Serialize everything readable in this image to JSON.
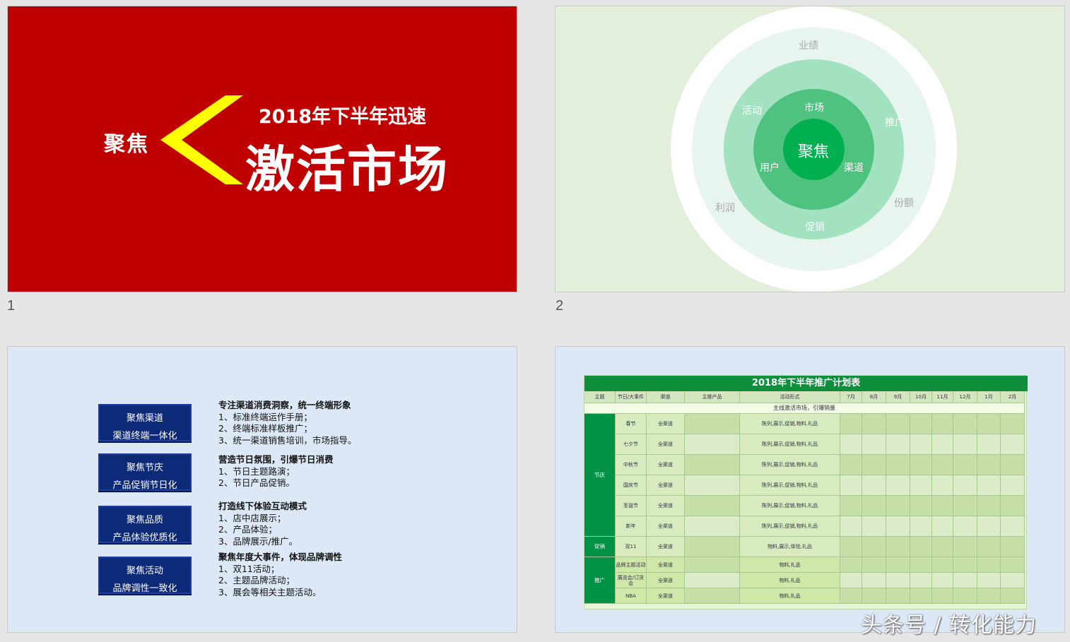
{
  "slides": [
    {
      "number": "1"
    },
    {
      "number": "2"
    },
    {
      "number": "3"
    },
    {
      "number": "4"
    }
  ],
  "slide1": {
    "focus": "聚焦",
    "subtitle": "2018年下半年迅速",
    "title": "激活市场",
    "bg_color": "#c00000",
    "chevron_color": "#ffff00"
  },
  "slide2": {
    "center": "聚焦",
    "inner_labels": {
      "top": "市场",
      "left": "用户",
      "right": "渠道"
    },
    "middle_labels": {
      "top_left": "活动",
      "right": "推广",
      "bottom": "促销"
    },
    "outer_labels": {
      "top": "业绩",
      "left": "利润",
      "right": "份额"
    },
    "colors": [
      "#00b050",
      "#4ec27e",
      "#a2e2c0",
      "#e7f5ee",
      "#ffffff"
    ]
  },
  "slide3": {
    "items": [
      {
        "box_line1": "聚焦渠道",
        "box_line2": "渠道终端一体化",
        "head": "专注渠道消费洞察，统一终端形象",
        "points": [
          "1、标准终端运作手册；",
          "2、终端标准样板推广；",
          "3、统一渠道销售培训，市场指导。"
        ]
      },
      {
        "box_line1": "聚焦节庆",
        "box_line2": "产品促销节日化",
        "head": "营造节日氛围，引爆节日消费",
        "points": [
          "1、节日主题路演；",
          "2、节日产品促销。"
        ]
      },
      {
        "box_line1": "聚焦品质",
        "box_line2": "产品体验优质化",
        "head": "打造线下体验互动模式",
        "points": [
          "1、店中店展示；",
          "2、产品体验；",
          "3、品牌展示/推广。"
        ]
      },
      {
        "box_line1": "聚焦活动",
        "box_line2": "品牌调性一致化",
        "head": "聚焦年度大事件，体现品牌调性",
        "points": [
          "1、双11活动；",
          "2、主题品牌活动；",
          "3、展会等相关主题活动。"
        ]
      }
    ]
  },
  "slide4": {
    "table_title": "2018年下半年推广计划表",
    "headers": [
      "主题",
      "节日/大事件",
      "渠道",
      "主推产品",
      "活动形式",
      "7月",
      "8月",
      "9月",
      "10月",
      "11月",
      "12月",
      "1月",
      "2月"
    ],
    "banner": "主线激活市场，引爆销量",
    "groups": [
      {
        "name": "节庆",
        "rows": [
          {
            "event": "春节",
            "channel": "全渠道",
            "form": "陈列,展示,促销,物料,礼品"
          },
          {
            "event": "七夕节",
            "channel": "全渠道",
            "form": "陈列,展示,促销,物料,礼品"
          },
          {
            "event": "中秋节",
            "channel": "全渠道",
            "form": "陈列,展示,促销,物料,礼品"
          },
          {
            "event": "国庆节",
            "channel": "全渠道",
            "form": "陈列,展示,促销,物料,礼品"
          },
          {
            "event": "圣诞节",
            "channel": "全渠道",
            "form": "陈列,展示,促销,物料,礼品"
          },
          {
            "event": "新年",
            "channel": "全渠道",
            "form": "陈列,展示,促销,物料,礼品"
          }
        ]
      },
      {
        "name": "促销",
        "rows": [
          {
            "event": "双11",
            "channel": "全渠道",
            "form": "物料,展示,体验,礼品"
          }
        ]
      },
      {
        "name": "推广",
        "rows": [
          {
            "event": "品牌主题活动",
            "channel": "全渠道",
            "form": "物料,礼品"
          },
          {
            "event": "展览会/订货会",
            "channel": "全渠道",
            "form": "物料,礼品"
          },
          {
            "event": "NBA",
            "channel": "全渠道",
            "form": "物料,礼品"
          }
        ]
      }
    ]
  },
  "watermark": "头条号 / 转化能力"
}
